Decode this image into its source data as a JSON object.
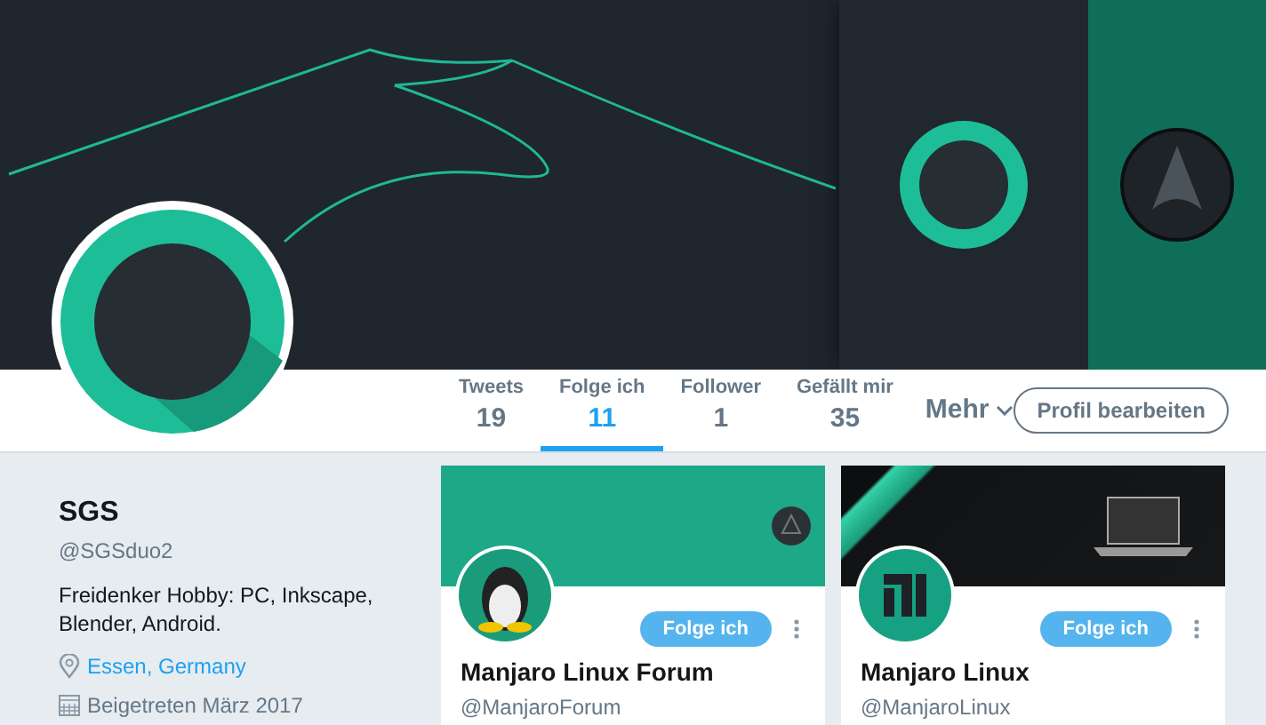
{
  "stats": [
    {
      "label": "Tweets",
      "value": "19",
      "selected": false
    },
    {
      "label": "Folge ich",
      "value": "11",
      "selected": true
    },
    {
      "label": "Follower",
      "value": "1",
      "selected": false
    },
    {
      "label": "Gefällt mir",
      "value": "35",
      "selected": false
    }
  ],
  "more": "Mehr",
  "edit_button": "Profil bearbeiten",
  "profile": {
    "name": "SGS",
    "handle": "@SGSduo2",
    "bio": "Freidenker Hobby: PC, Inkscape, Blender, Android.",
    "location": "Essen, Germany",
    "joined": "Beigetreten März 2017"
  },
  "cards": [
    {
      "kind": "forum",
      "name": "Manjaro Linux Forum",
      "handle": "@ManjaroForum",
      "button": "Folge ich"
    },
    {
      "kind": "distro",
      "name": "Manjaro Linux",
      "handle": "@ManjaroLinux",
      "button": "Folge ich"
    }
  ]
}
